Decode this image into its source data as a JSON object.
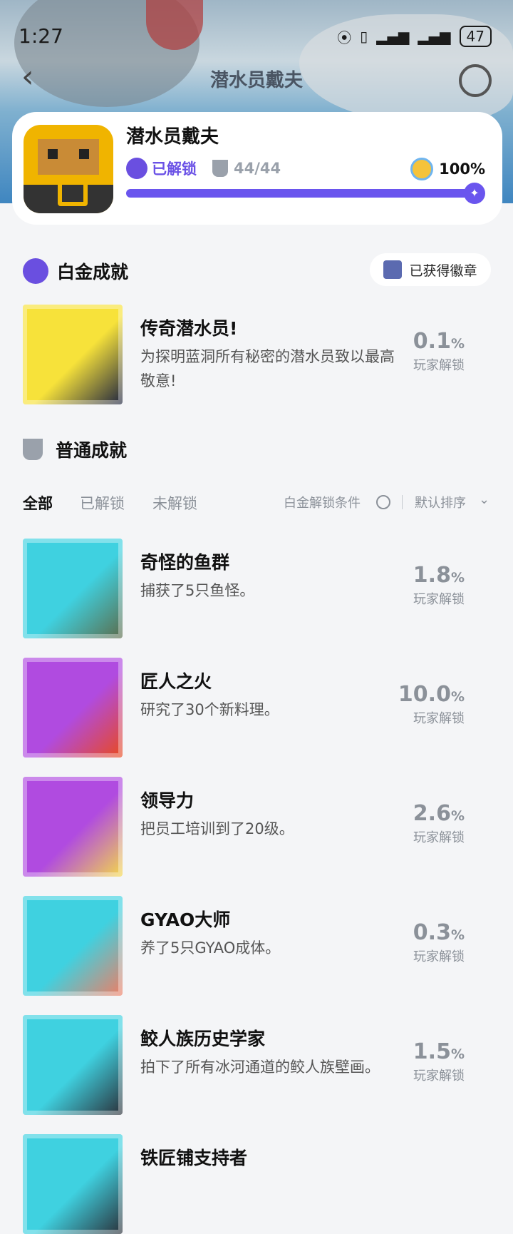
{
  "status_bar": {
    "time": "1:27",
    "battery": "47"
  },
  "nav": {
    "title": "潜水员戴夫"
  },
  "game": {
    "name": "潜水员戴夫",
    "unlocked_label": "已解锁",
    "count": "44/44",
    "percent": "100%",
    "progress": 1.0,
    "progress_icon": "✦"
  },
  "platinum": {
    "section_title": "白金成就",
    "badge_button": "已获得徽章",
    "item": {
      "name": "传奇潜水员!",
      "desc": "为探明蓝洞所有秘密的潜水员致以最高敬意!",
      "value": "0.1",
      "unit": "%",
      "label": "玩家解锁",
      "thumb_colors": [
        "#f7e23a",
        "#1d2340"
      ]
    }
  },
  "normal": {
    "section_title": "普通成就",
    "tabs": [
      "全部",
      "已解锁",
      "未解锁"
    ],
    "platinum_condition": "白金解锁条件",
    "sort": "默认排序",
    "items": [
      {
        "name": "奇怪的鱼群",
        "desc": "捕获了5只鱼怪。",
        "value": "1.8",
        "unit": "%",
        "label": "玩家解锁",
        "thumb_colors": [
          "#3fd1e0",
          "#5b6b4a"
        ]
      },
      {
        "name": "匠人之火",
        "desc": "研究了30个新料理。",
        "value": "10.0",
        "unit": "%",
        "label": "玩家解锁",
        "thumb_colors": [
          "#b04be0",
          "#e94a1d"
        ]
      },
      {
        "name": "领导力",
        "desc": "把员工培训到了20级。",
        "value": "2.6",
        "unit": "%",
        "label": "玩家解锁",
        "thumb_colors": [
          "#b04be0",
          "#f4d84a"
        ]
      },
      {
        "name": "GYAO大师",
        "desc": "养了5只GYAO成体。",
        "value": "0.3",
        "unit": "%",
        "label": "玩家解锁",
        "thumb_colors": [
          "#3fd1e0",
          "#f07d63"
        ]
      },
      {
        "name": "鲛人族历史学家",
        "desc": "拍下了所有冰河通道的鲛人族壁画。",
        "value": "1.5",
        "unit": "%",
        "label": "玩家解锁",
        "thumb_colors": [
          "#3fd1e0",
          "#2a2f38"
        ]
      },
      {
        "name": "铁匠铺支持者",
        "desc": "",
        "value": "",
        "unit": "",
        "label": "",
        "thumb_colors": [
          "#3fd1e0",
          "#2a2f38"
        ]
      }
    ]
  }
}
